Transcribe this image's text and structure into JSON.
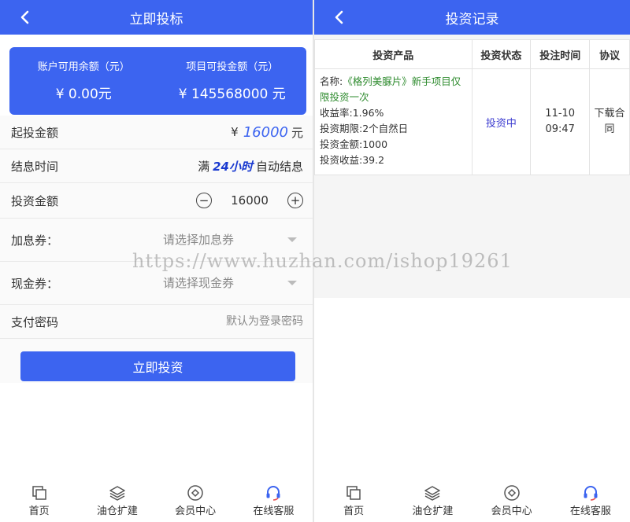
{
  "left": {
    "header": {
      "title": "立即投标"
    },
    "card": {
      "available_label": "账户可用余额（元）",
      "available_value": "¥ 0.00元",
      "project_label": "项目可投金额（元）",
      "project_value": "¥ 145568000 元"
    },
    "rows": {
      "min_label": "起投金额",
      "min_yen": "¥",
      "min_value": "16000",
      "min_unit": "元",
      "interest_label": "结息时间",
      "interest_prefix": "满",
      "interest_hours": "24小时",
      "interest_suffix": "自动结息",
      "amount_label": "投资金额",
      "amount_value": "16000",
      "minus": "−",
      "plus": "+",
      "bonus_label": "加息券：",
      "bonus_placeholder": "请选择加息券",
      "cash_label": "现金券：",
      "cash_placeholder": "请选择现金券",
      "pwd_label": "支付密码",
      "pwd_placeholder": "默认为登录密码"
    },
    "invest_button": "立即投资"
  },
  "right": {
    "header": {
      "title": "投资记录"
    },
    "table": {
      "headers": [
        "投资产品",
        "投资状态",
        "投注时间",
        "协议"
      ],
      "row": {
        "name_prefix": "名称:",
        "name_value": "《格列美脲片》新手项目仅限投资一次",
        "rate": "收益率:1.96%",
        "period": "投资期限:2个自然日",
        "amount": "投资金额:1000",
        "income": "投资收益:39.2",
        "status": "投资中",
        "date": "11-10",
        "time": "09:47",
        "protocol": "下载合同"
      }
    }
  },
  "nav": [
    "首页",
    "油仓扩建",
    "会员中心",
    "在线客服"
  ],
  "watermark": "https://www.huzhan.com/ishop19261",
  "colors": {
    "brand": "#3c64f0",
    "green": "#2e8b2e",
    "status": "#3c3cd0"
  }
}
